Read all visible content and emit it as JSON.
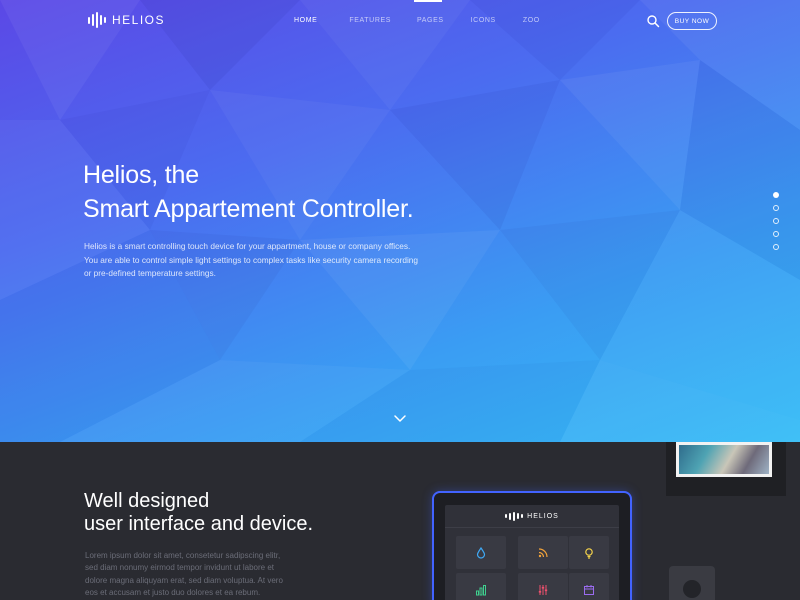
{
  "brand": {
    "name": "HELIOS"
  },
  "nav": {
    "items": [
      {
        "label": "HOME",
        "active": true
      },
      {
        "label": "FEATURES",
        "active": false
      },
      {
        "label": "PAGES",
        "active": false
      },
      {
        "label": "ICONS",
        "active": false
      },
      {
        "label": "ZOO",
        "active": false
      }
    ],
    "search_icon": "search-icon",
    "cta_label": "BUY NOW"
  },
  "hero": {
    "title_line1": "Helios, the",
    "title_line2": "Smart Appartement Controller.",
    "description": "Helios is a smart controlling touch device for your appartment, house or company offices. You are able to control simple light settings to complex tasks like security camera recording or pre-defined temperature settings.",
    "slides": {
      "count": 5,
      "active_index": 0
    },
    "scroll_icon": "chevron-down-icon"
  },
  "features": {
    "title_line1": "Well designed",
    "title_line2": "user interface and device.",
    "description": "Lorem ipsum dolor sit amet, consetetur sadipscing elitr, sed diam nonumy eirmod tempor invidunt ut labore et dolore magna aliquyam erat, sed diam voluptua. At vero eos et accusam et justo duo dolores et ea rebum."
  },
  "device": {
    "brand": "HELIOS",
    "tiles": [
      {
        "icon": "water-drop-icon",
        "color": "#3fa9f5"
      },
      {
        "icon": "rss-icon",
        "color": "#f2a33a"
      },
      {
        "icon": "lightbulb-icon",
        "color": "#f5d34a"
      },
      {
        "icon": "bar-chart-icon",
        "color": "#3fd08f"
      },
      {
        "icon": "sliders-icon",
        "color": "#f0506e"
      },
      {
        "icon": "calendar-icon",
        "color": "#9b6cf0"
      }
    ]
  },
  "colors": {
    "hero_gradient_start": "#5b48e6",
    "hero_gradient_end": "#36bdf6",
    "section_dark": "#2a2b31",
    "tablet_glow": "#4263ff"
  }
}
